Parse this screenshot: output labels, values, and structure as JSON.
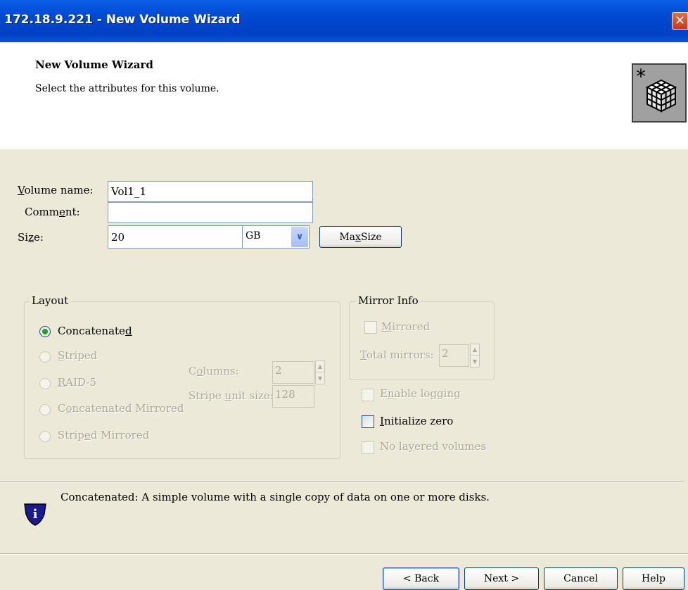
{
  "window": {
    "title": "172.18.9.221 - New Volume Wizard",
    "close_glyph": "✕"
  },
  "header": {
    "title": "New Volume Wizard",
    "subtitle": "Select the attributes for this volume.",
    "icon": "volume-wizard-cube-icon"
  },
  "form": {
    "volume_name_label_pre": "",
    "volume_name_label_u": "V",
    "volume_name_label_post": "olume name:",
    "volume_name_value": "Vol1_1",
    "comment_label_pre": "Comm",
    "comment_label_u": "e",
    "comment_label_post": "nt:",
    "comment_value": "",
    "size_label_pre": "Si",
    "size_label_u": "z",
    "size_label_post": "e:",
    "size_value": "20",
    "size_unit": "GB",
    "max_size_pre": "Ma",
    "max_size_u": "x",
    "max_size_post": " Size"
  },
  "layout_group": {
    "legend": "Layout",
    "concatenated_pre": "Concatenate",
    "concatenated_u": "d",
    "striped_u": "S",
    "striped_post": "triped",
    "raid5_u": "R",
    "raid5_post": "AID-5",
    "concat_mirrored_pre": "C",
    "concat_mirrored_u": "o",
    "concat_mirrored_post": "ncatenated Mirrored",
    "striped_mirrored_pre": "Strip",
    "striped_mirrored_u": "e",
    "striped_mirrored_post": "d Mirrored",
    "columns_pre": "C",
    "columns_u": "o",
    "columns_post": "lumns:",
    "columns_value": "2",
    "stripe_unit_pre": "Stripe ",
    "stripe_unit_u": "u",
    "stripe_unit_post": "nit size:",
    "stripe_unit_value": "128",
    "selected": "concatenated"
  },
  "mirror_group": {
    "legend": "Mirror Info",
    "mirrored_u": "M",
    "mirrored_post": "irrored",
    "total_mirrors_u": "T",
    "total_mirrors_post": "otal mirrors:",
    "total_mirrors_value": "2"
  },
  "options": {
    "enable_logging_pre": "E",
    "enable_logging_u": "n",
    "enable_logging_post": "able logging",
    "initialize_zero_u": "I",
    "initialize_zero_post": "nitialize zero",
    "no_layered_pre": "No la",
    "no_layered_u": "y",
    "no_layered_post": "ered volumes"
  },
  "info": {
    "text": "Concatenated: A simple volume with a single copy of data on one or more disks.",
    "icon": "info-shield-icon"
  },
  "footer": {
    "back": "< Back",
    "next": "Next >",
    "cancel": "Cancel",
    "help": "Help"
  },
  "colors": {
    "titlebar": "#0048D0",
    "dialog_bg": "#ECE9D8",
    "header_bg": "#FFFFFF",
    "radio_selected": "#21A121"
  }
}
